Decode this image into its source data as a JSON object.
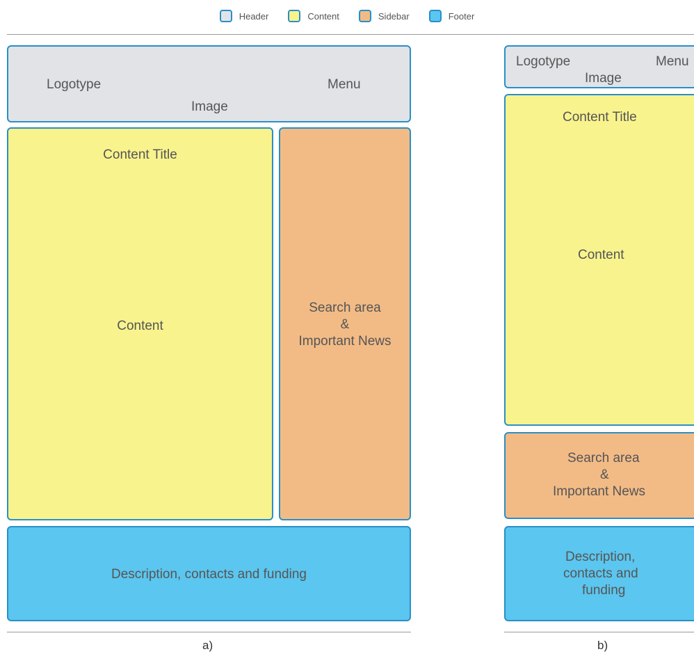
{
  "legend": [
    {
      "label": "Header",
      "color": "#e1e3e7"
    },
    {
      "label": "Content",
      "color": "#f8f38d"
    },
    {
      "label": "Sidebar",
      "color": "#f2bb86"
    },
    {
      "label": "Footer",
      "color": "#5bc6ef"
    }
  ],
  "layout_a": {
    "header": {
      "logo": "Logotype",
      "menu": "Menu",
      "image": "Image"
    },
    "content": {
      "title": "Content Title",
      "body": "Content"
    },
    "sidebar": {
      "line1": "Search area",
      "line2": "&",
      "line3": "Important News"
    },
    "footer": {
      "text": "Description, contacts and funding"
    },
    "caption": "a)"
  },
  "layout_b": {
    "header": {
      "logo": "Logotype",
      "menu": "Menu",
      "image": "Image"
    },
    "content": {
      "title": "Content Title",
      "body": "Content"
    },
    "sidebar": {
      "line1": "Search area",
      "line2": "&",
      "line3": "Important News"
    },
    "footer": {
      "line1": "Description,",
      "line2": "contacts and",
      "line3": "funding"
    },
    "caption": "b)"
  }
}
